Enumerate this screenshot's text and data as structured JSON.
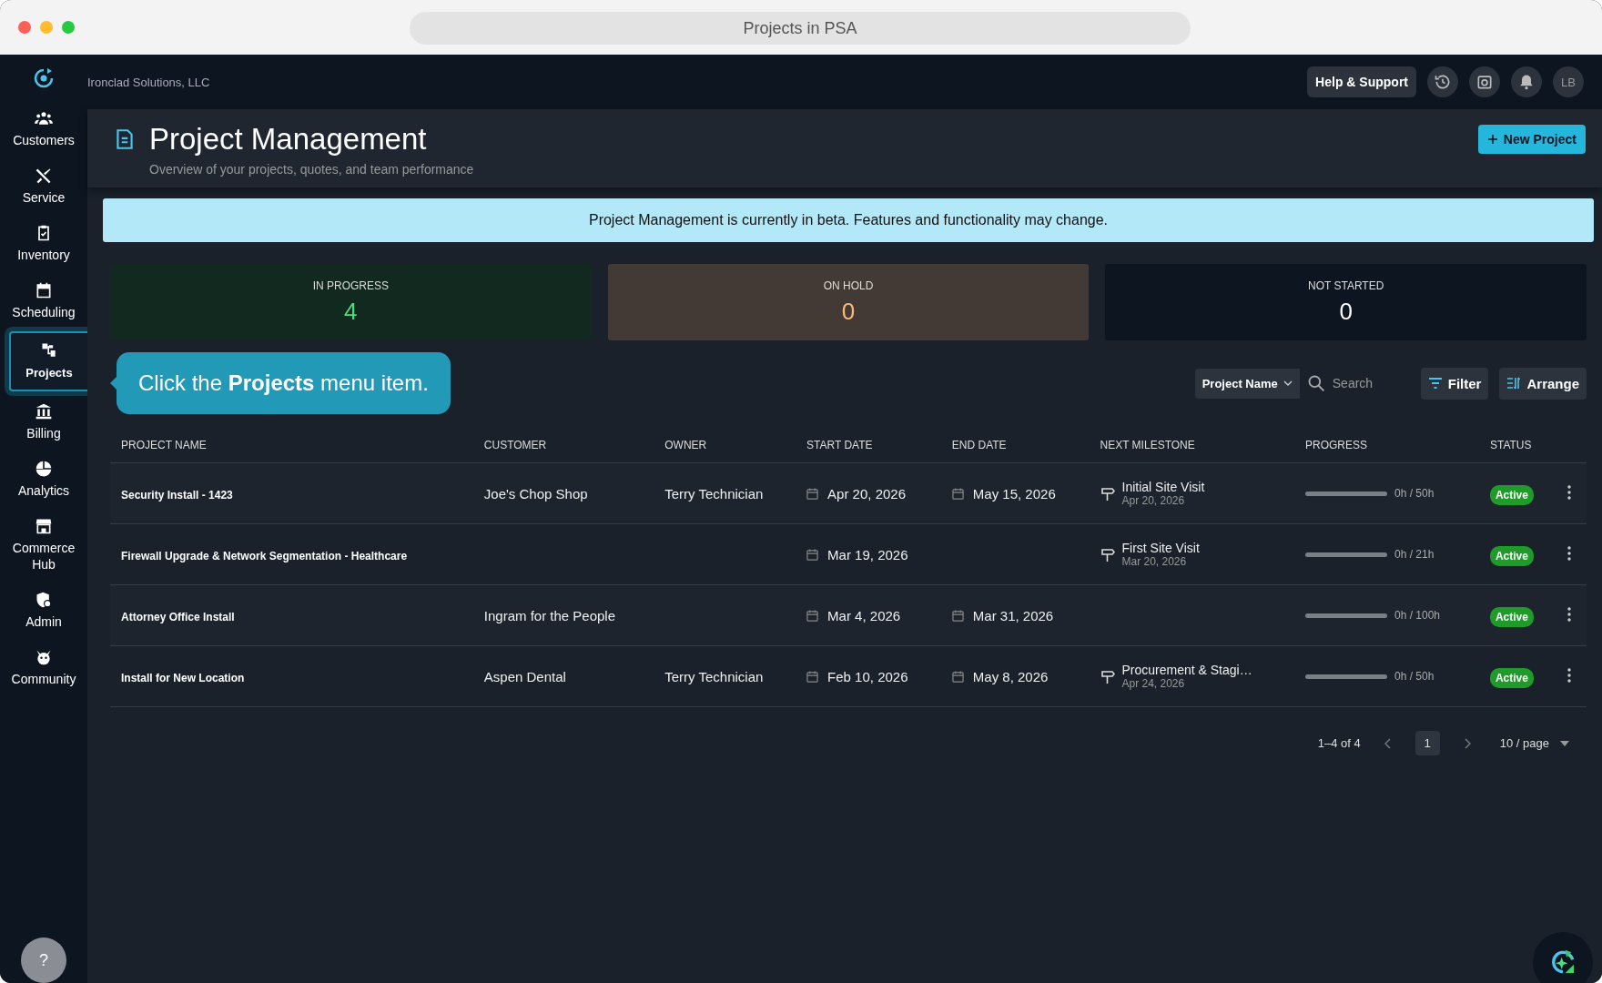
{
  "window": {
    "title": "Projects in PSA"
  },
  "topbar": {
    "company": "Ironclad Solutions, LLC",
    "help": "Help & Support",
    "avatar": "LB"
  },
  "sidebar": {
    "items": [
      {
        "label": "Customers",
        "selected": false
      },
      {
        "label": "Service",
        "selected": false
      },
      {
        "label": "Inventory",
        "selected": false
      },
      {
        "label": "Scheduling",
        "selected": false
      },
      {
        "label": "Projects",
        "selected": true
      },
      {
        "label": "Billing",
        "selected": false
      },
      {
        "label": "Analytics",
        "selected": false
      },
      {
        "label": "Commerce Hub",
        "selected": false
      },
      {
        "label": "Admin",
        "selected": false
      },
      {
        "label": "Community",
        "selected": false
      }
    ],
    "help": "?"
  },
  "header": {
    "title": "Project Management",
    "subtitle": "Overview of your projects, quotes, and team performance",
    "new_button": "New Project"
  },
  "banner": "Project Management is currently in beta. Features and functionality may change.",
  "stats": [
    {
      "kind": "in-progress",
      "label": "IN PROGRESS",
      "value": "4"
    },
    {
      "kind": "on-hold",
      "label": "ON HOLD",
      "value": "0"
    },
    {
      "kind": "not-started",
      "label": "NOT STARTED",
      "value": "0"
    }
  ],
  "tooltip": "Click the **Projects** menu item.",
  "toolbar": {
    "field_select": "Project Name",
    "search": {
      "placeholder": "Search"
    },
    "filter": "Filter",
    "arrange": "Arrange"
  },
  "table": {
    "columns": [
      "PROJECT NAME",
      "CUSTOMER",
      "OWNER",
      "START DATE",
      "END DATE",
      "NEXT MILESTONE",
      "PROGRESS",
      "STATUS"
    ],
    "rows": [
      {
        "name": "Security Install - 1423",
        "customer": "Joe's Chop Shop",
        "owner": "Terry Technician",
        "start": "Apr 20, 2026",
        "end": "May 15, 2026",
        "milestone": "Initial Site Visit",
        "milestone_date": "Apr 20, 2026",
        "level": 0,
        "hours": "0h / 50h",
        "status": "Active"
      },
      {
        "name": "Firewall Upgrade & Network Segmentation - Healthcare",
        "start": "Mar 19, 2026",
        "milestone": "First Site Visit",
        "milestone_date": "Mar 20, 2026",
        "level": 0,
        "hours": "0h / 21h",
        "status": "Active"
      },
      {
        "name": "Attorney Office Install",
        "customer": "Ingram for the People",
        "start": "Mar 4, 2026",
        "end": "Mar 31, 2026",
        "level": 0,
        "hours": "0h / 100h",
        "status": "Active"
      },
      {
        "name": "Install for New Location",
        "customer": "Aspen Dental",
        "owner": "Terry Technician",
        "start": "Feb 10, 2026",
        "end": "May 8, 2026",
        "milestone": "Procurement & Stagi…",
        "milestone_date": "Apr 24, 2026",
        "level": 0,
        "hours": "0h / 50h",
        "status": "Active"
      }
    ]
  },
  "pagination": {
    "range": "1–4 of 4",
    "pages": [
      {
        "label": "1",
        "selected": true
      }
    ],
    "page_size": "10 / page"
  }
}
